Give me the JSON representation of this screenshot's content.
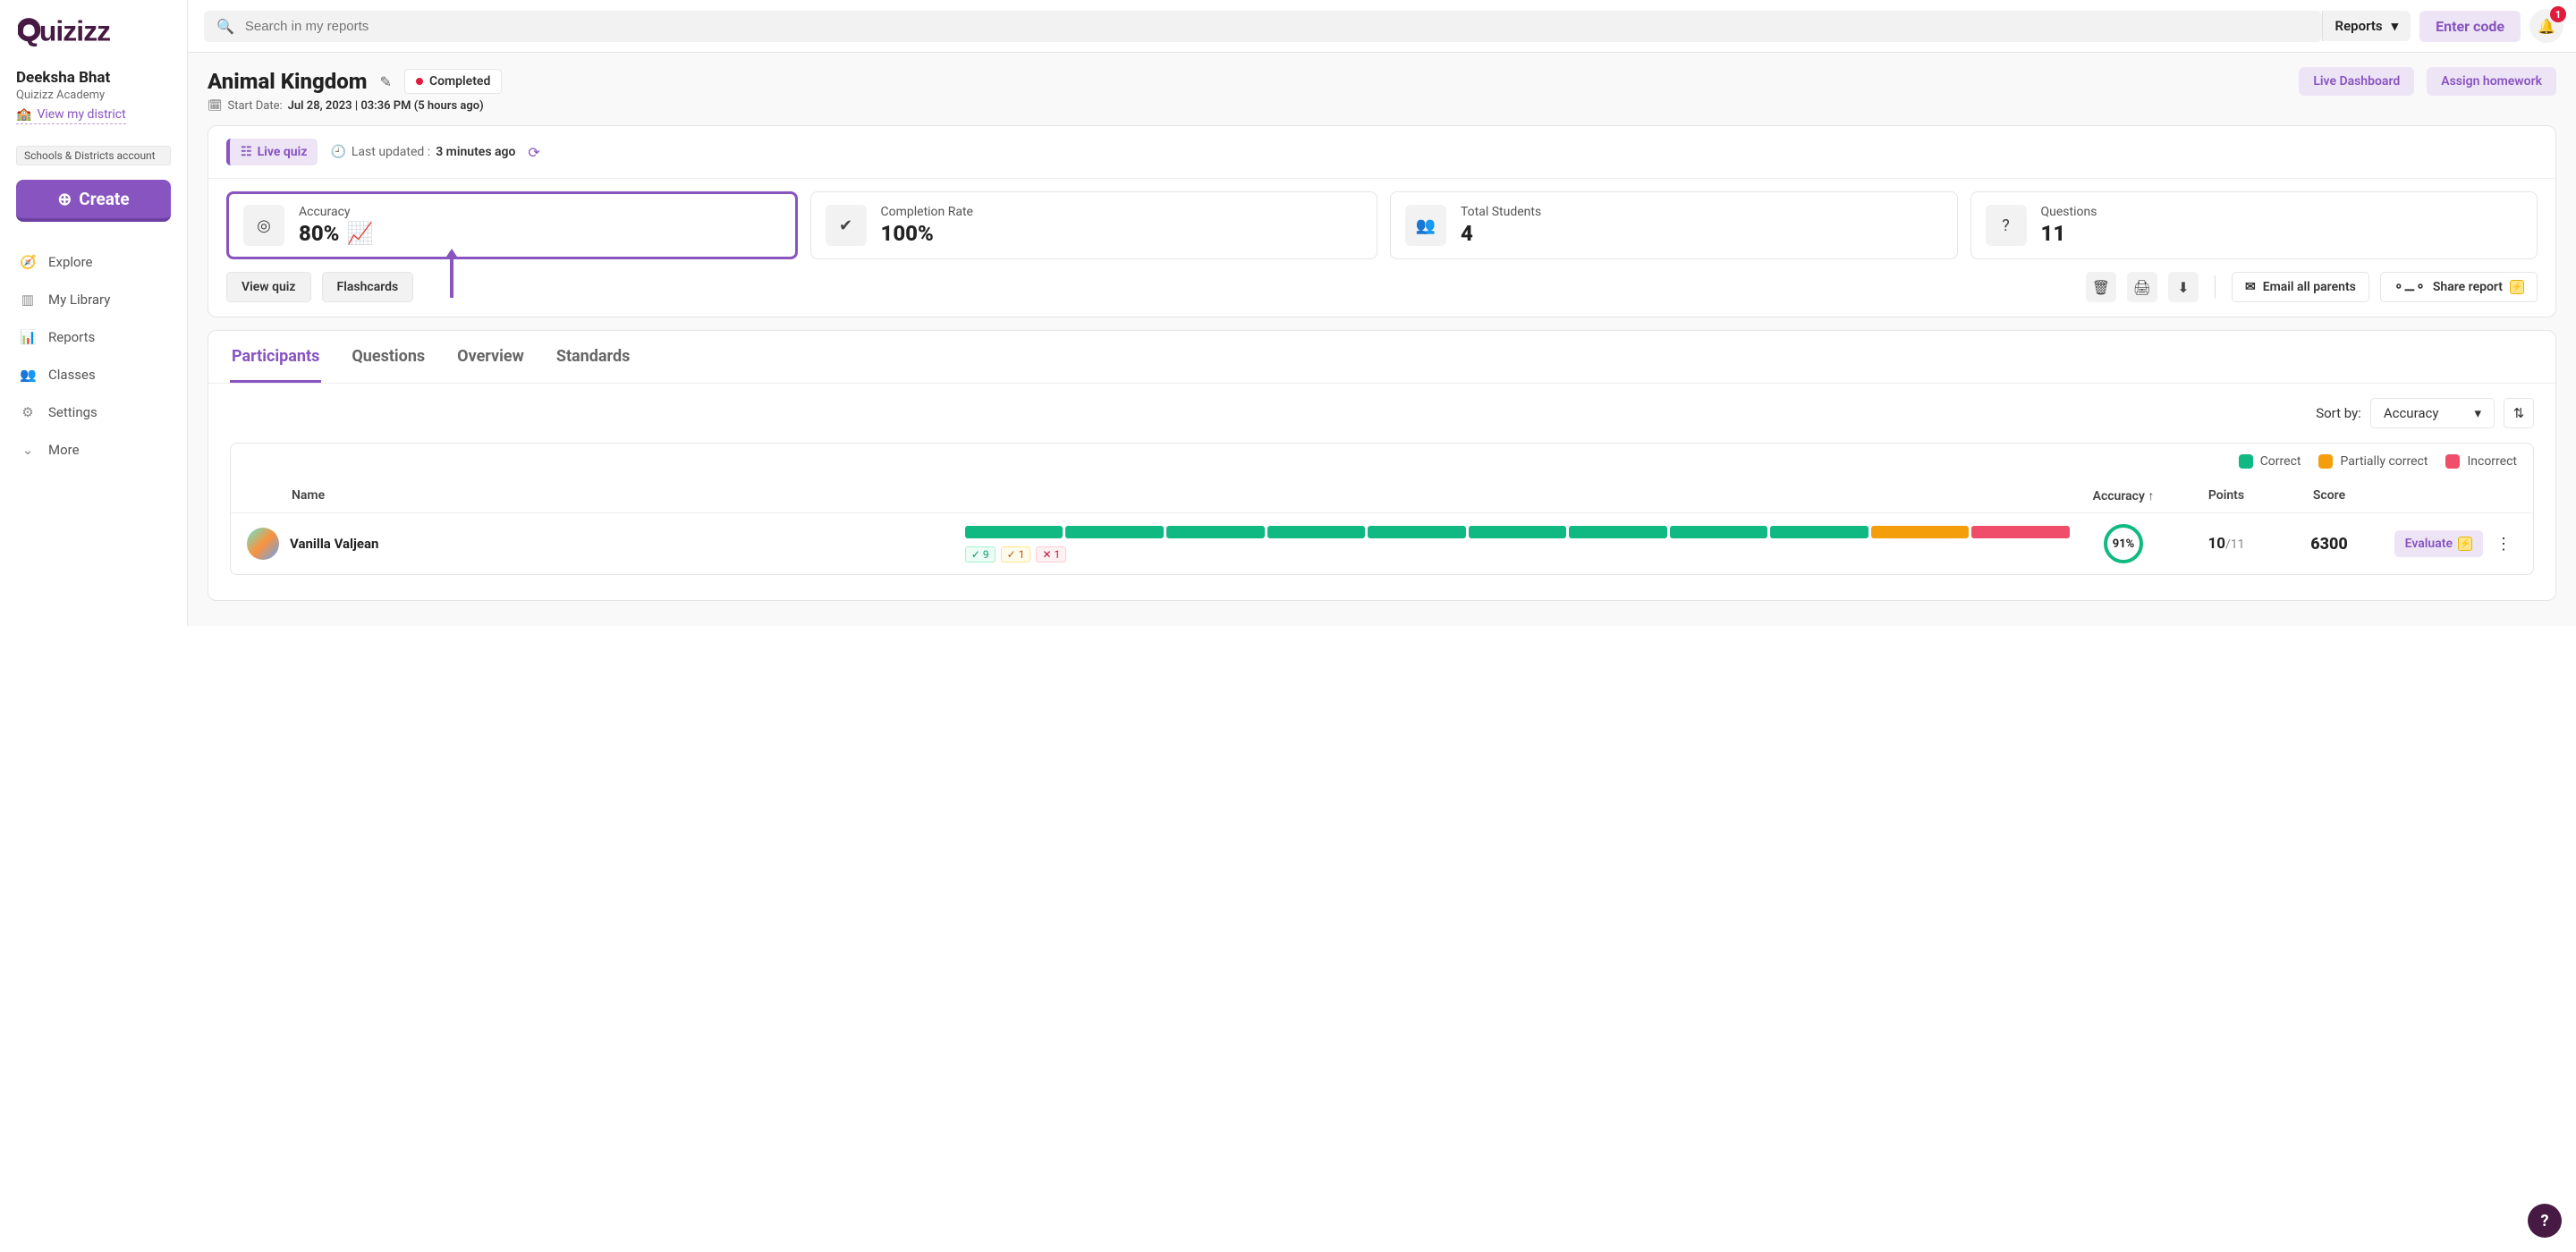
{
  "brand": "Quizizz",
  "user": {
    "name": "Deeksha Bhat",
    "org": "Quizizz Academy",
    "district_link": "View my district",
    "account_badge": "Schools & Districts account"
  },
  "create_label": "Create",
  "nav": {
    "explore": "Explore",
    "library": "My Library",
    "reports": "Reports",
    "classes": "Classes",
    "settings": "Settings",
    "more": "More"
  },
  "topbar": {
    "search_placeholder": "Search in my reports",
    "segment_label": "Reports",
    "enter_code": "Enter code",
    "notif_count": "1"
  },
  "report": {
    "title": "Animal Kingdom",
    "status": "Completed",
    "live_dashboard": "Live Dashboard",
    "assign_homework": "Assign homework",
    "start_date_label": "Start Date:",
    "start_date_value": "Jul 28, 2023 | 03:36 PM (5 hours ago)",
    "live_quiz": "Live quiz",
    "last_updated_label": "Last updated :",
    "last_updated_value": "3 minutes ago",
    "stats": {
      "accuracy_label": "Accuracy",
      "accuracy_value": "80%",
      "completion_label": "Completion Rate",
      "completion_value": "100%",
      "students_label": "Total Students",
      "students_value": "4",
      "questions_label": "Questions",
      "questions_value": "11"
    },
    "actions": {
      "view_quiz": "View quiz",
      "flashcards": "Flashcards",
      "email_parents": "Email all parents",
      "share_report": "Share report"
    }
  },
  "tabs": {
    "participants": "Participants",
    "questions": "Questions",
    "overview": "Overview",
    "standards": "Standards"
  },
  "sort": {
    "label": "Sort by:",
    "value": "Accuracy"
  },
  "legend": {
    "correct": "Correct",
    "partial": "Partially correct",
    "incorrect": "Incorrect"
  },
  "colors": {
    "correct": "#10b981",
    "partial": "#f59e0b",
    "incorrect": "#ef4d6a"
  },
  "table": {
    "headers": {
      "name": "Name",
      "accuracy": "Accuracy ↑",
      "points": "Points",
      "score": "Score"
    },
    "rows": [
      {
        "name": "Vanilla Valjean",
        "correct": "9",
        "partial": "1",
        "incorrect": "1",
        "accuracy": "91%",
        "points_num": "10",
        "points_den": "/11",
        "score": "6300",
        "evaluate": "Evaluate"
      }
    ]
  }
}
